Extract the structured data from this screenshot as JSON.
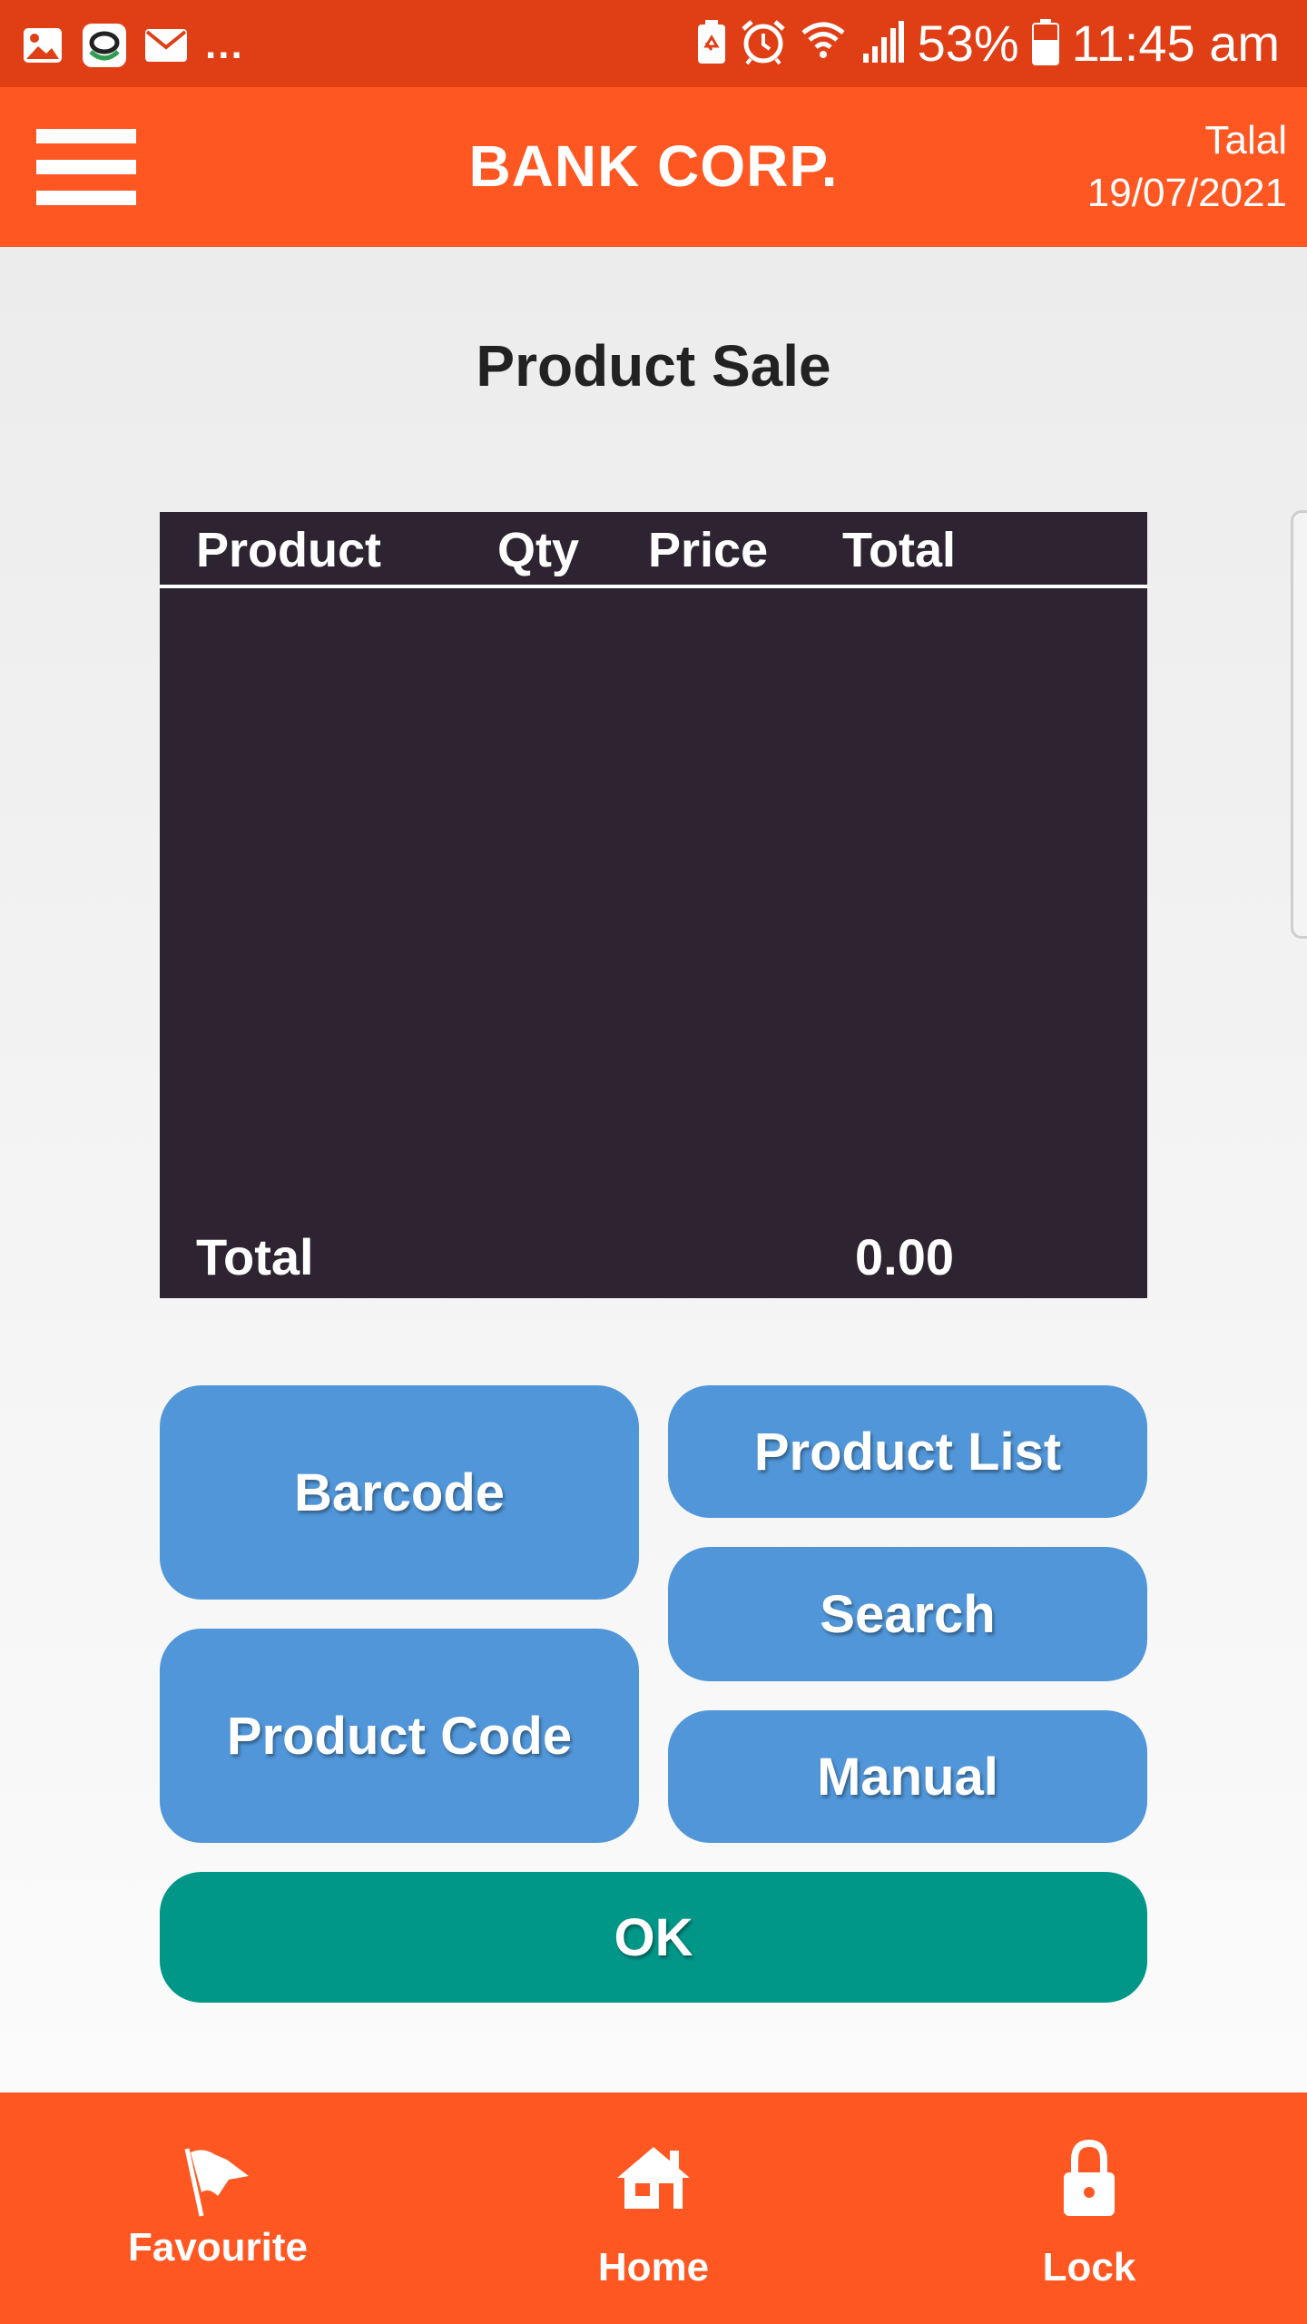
{
  "status_bar": {
    "more_indicator": "...",
    "battery_percent": "53%",
    "time": "11:45 am",
    "icons": [
      "gallery-icon",
      "app-notification-icon",
      "mail-icon",
      "battery-saver-icon",
      "alarm-icon",
      "wifi-icon",
      "signal-icon",
      "battery-icon"
    ]
  },
  "header": {
    "title": "BANK CORP.",
    "user_name": "Talal",
    "date": "19/07/2021"
  },
  "page": {
    "title": "Product Sale"
  },
  "table": {
    "columns": [
      "Product",
      "Qty",
      "Price",
      "Total"
    ],
    "rows": [],
    "total_label": "Total",
    "total_value": "0.00"
  },
  "buttons": {
    "barcode": "Barcode",
    "product_code": "Product Code",
    "product_list": "Product List",
    "search": "Search",
    "manual": "Manual",
    "ok": "OK"
  },
  "bottom_nav": {
    "items": [
      {
        "label": "Favourite",
        "icon": "flag-icon"
      },
      {
        "label": "Home",
        "icon": "home-icon"
      },
      {
        "label": "Lock",
        "icon": "lock-icon"
      }
    ]
  },
  "colors": {
    "status_bar": "#e03f16",
    "primary": "#ff5722",
    "table_bg": "#2e2431",
    "button_blue": "#5096d8",
    "button_green": "#009688"
  }
}
